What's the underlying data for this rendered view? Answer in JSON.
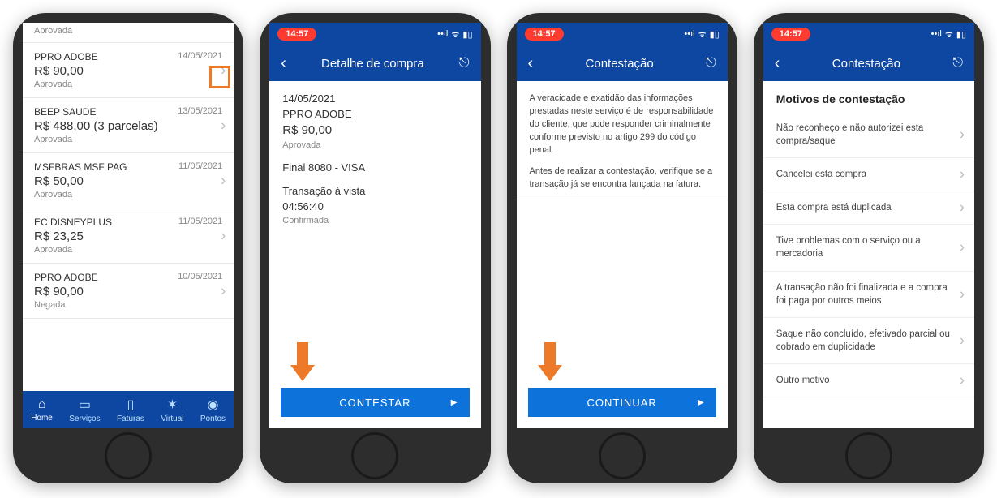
{
  "status_time": "14:57",
  "screen1": {
    "top_status": "Aprovada",
    "transactions": [
      {
        "merchant": "PPRO ADOBE",
        "date": "14/05/2021",
        "amount": "R$ 90,00",
        "status": "Aprovada",
        "highlight": true
      },
      {
        "merchant": "BEEP SAUDE",
        "date": "13/05/2021",
        "amount": "R$ 488,00 (3 parcelas)",
        "status": "Aprovada",
        "highlight": false
      },
      {
        "merchant": "MSFBRAS MSF PAG",
        "date": "11/05/2021",
        "amount": "R$ 50,00",
        "status": "Aprovada",
        "highlight": false
      },
      {
        "merchant": "EC DISNEYPLUS",
        "date": "11/05/2021",
        "amount": "R$ 23,25",
        "status": "Aprovada",
        "highlight": false
      },
      {
        "merchant": "PPRO ADOBE",
        "date": "10/05/2021",
        "amount": "R$ 90,00",
        "status": "Negada",
        "highlight": false
      }
    ],
    "tabs": [
      {
        "label": "Home",
        "icon": "⌂"
      },
      {
        "label": "Serviços",
        "icon": "▭"
      },
      {
        "label": "Faturas",
        "icon": "▯"
      },
      {
        "label": "Virtual",
        "icon": "✶"
      },
      {
        "label": "Pontos",
        "icon": "◉"
      }
    ]
  },
  "screen2": {
    "title": "Detalhe de compra",
    "date": "14/05/2021",
    "merchant": "PPRO ADOBE",
    "amount": "R$ 90,00",
    "status": "Aprovada",
    "card": "Final 8080 - VISA",
    "type": "Transação à vista",
    "time": "04:56:40",
    "confirm": "Confirmada",
    "cta": "CONTESTAR"
  },
  "screen3": {
    "title": "Contestação",
    "para1": "A veracidade e exatidão das informações prestadas neste serviço é de responsabilidade do cliente, que pode responder criminalmente conforme previsto no artigo 299 do código penal.",
    "para2": "Antes de realizar a contestação, verifique se a transação já se encontra lançada na fatura.",
    "cta": "CONTINUAR"
  },
  "screen4": {
    "title": "Contestação",
    "section": "Motivos de contestação",
    "reasons": [
      "Não reconheço e não autorizei esta compra/saque",
      "Cancelei esta compra",
      "Esta compra está duplicada",
      "Tive problemas com o serviço ou a mercadoria",
      "A transação não foi finalizada e a compra foi paga por outros meios",
      "Saque não concluído, efetivado parcial ou cobrado em duplicidade",
      "Outro motivo"
    ]
  }
}
